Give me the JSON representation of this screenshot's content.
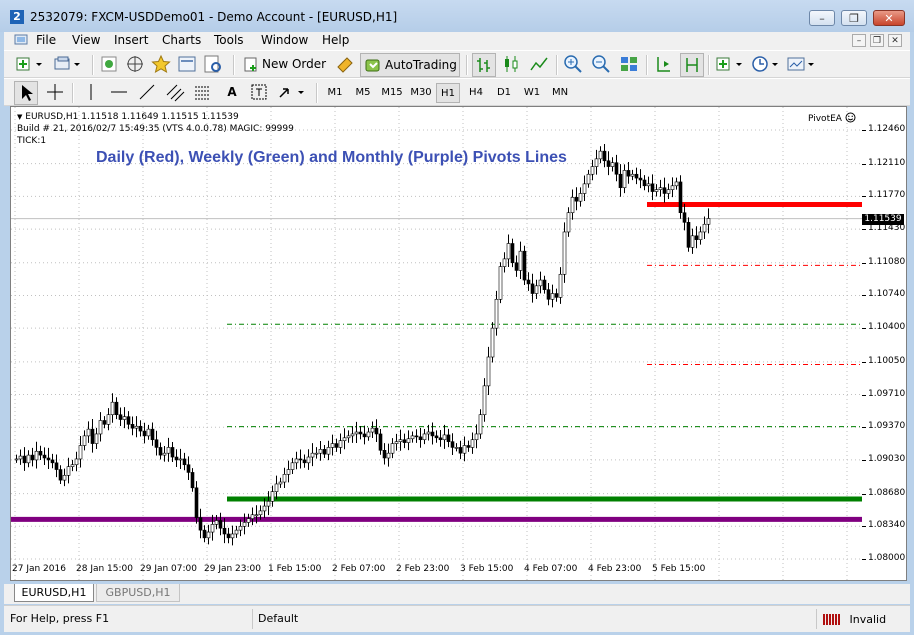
{
  "window": {
    "title": "2532079: FXCM-USDDemo01 - Demo Account - [EURUSD,H1]",
    "minimize_glyph": "–",
    "restore_glyph": "❐",
    "close_glyph": "✕"
  },
  "menu": {
    "items": [
      "File",
      "View",
      "Insert",
      "Charts",
      "Tools",
      "Window",
      "Help"
    ]
  },
  "toolbar": {
    "new_order_label": "New Order",
    "autotrading_label": "AutoTrading",
    "draw_text_tool": "A",
    "timeframes": [
      "M1",
      "M5",
      "M15",
      "M30",
      "H1",
      "H4",
      "D1",
      "W1",
      "MN"
    ],
    "active_timeframe": "H1"
  },
  "chart": {
    "symbol_info": "EURUSD,H1  1.11518 1.11649 1.11515 1.11539",
    "build_info": "Build # 21, 2016/02/7 15:49:35  (VTS 4.0.0.78) MAGIC: 99999",
    "tick_info": "TICK:1",
    "ea_name": "PivotEA",
    "annotation": "Daily (Red), Weekly (Green) and Monthly (Purple) Pivots Lines",
    "current_price": "1.11539",
    "price_labels": [
      "1.12460",
      "1.12110",
      "1.11770",
      "1.11430",
      "1.11080",
      "1.10740",
      "1.10400",
      "1.10050",
      "1.09710",
      "1.09370",
      "1.09030",
      "1.08680",
      "1.08340",
      "1.08000"
    ],
    "time_labels": [
      "27 Jan 2016",
      "28 Jan 15:00",
      "29 Jan 07:00",
      "29 Jan 23:00",
      "1 Feb 15:00",
      "2 Feb 07:00",
      "2 Feb 23:00",
      "3 Feb 15:00",
      "4 Feb 07:00",
      "4 Feb 23:00",
      "5 Feb 15:00"
    ],
    "colors": {
      "daily_pivot": "#ff0000",
      "weekly_pivot": "#008000",
      "monthly_pivot": "#800080",
      "candles": "#000000",
      "grid": "#c0c0c0"
    }
  },
  "chart_data": {
    "type": "candlestick",
    "symbol": "EURUSD",
    "timeframe": "H1",
    "ylim": [
      1.0795,
      1.1262
    ],
    "grid": true,
    "close_series": [
      1.0904,
      1.0907,
      1.09,
      1.0908,
      1.0903,
      1.0912,
      1.0908,
      1.0905,
      1.0903,
      1.09,
      1.0893,
      1.0882,
      1.0887,
      1.0896,
      1.0898,
      1.0904,
      1.0918,
      1.0928,
      1.0935,
      1.092,
      1.093,
      1.0944,
      1.094,
      1.095,
      1.0963,
      1.095,
      1.0945,
      1.0948,
      1.094,
      1.0936,
      1.0938,
      1.0933,
      1.0928,
      1.0935,
      1.0924,
      1.0916,
      1.0908,
      1.091,
      1.0916,
      1.0906,
      1.0903,
      1.0904,
      1.0898,
      1.089,
      1.0874,
      1.0843,
      1.083,
      1.0822,
      1.0828,
      1.0836,
      1.084,
      1.0832,
      1.0826,
      1.0822,
      1.0826,
      1.083,
      1.0834,
      1.0838,
      1.0842,
      1.0846,
      1.0846,
      1.085,
      1.0855,
      1.086,
      1.087,
      1.0878,
      1.088,
      1.0888,
      1.0893,
      1.09,
      1.0904,
      1.0903,
      1.09,
      1.0906,
      1.091,
      1.091,
      1.0914,
      1.0909,
      1.0916,
      1.092,
      1.0916,
      1.0923,
      1.0926,
      1.0928,
      1.093,
      1.0932,
      1.093,
      1.0927,
      1.0932,
      1.0936,
      1.093,
      1.0913,
      1.0905,
      1.091,
      1.092,
      1.0922,
      1.0924,
      1.0921,
      1.0925,
      1.0928,
      1.0927,
      1.0924,
      1.093,
      1.0932,
      1.0928,
      1.0926,
      1.0924,
      1.0929,
      1.0922,
      1.0916,
      1.0916,
      1.091,
      1.0918,
      1.0916,
      1.0924,
      1.093,
      1.095,
      1.098,
      1.101,
      1.104,
      1.107,
      1.1104,
      1.1112,
      1.1128,
      1.1108,
      1.11,
      1.112,
      1.109,
      1.1086,
      1.1076,
      1.1084,
      1.109,
      1.108,
      1.107,
      1.1076,
      1.1072,
      1.1096,
      1.114,
      1.116,
      1.1176,
      1.1172,
      1.118,
      1.119,
      1.12,
      1.1208,
      1.1216,
      1.1224,
      1.1214,
      1.1208,
      1.1212,
      1.12,
      1.1186,
      1.1204,
      1.1198,
      1.12,
      1.1196,
      1.1194,
      1.1188,
      1.119,
      1.1182,
      1.1184,
      1.1186,
      1.118,
      1.1184,
      1.1188,
      1.1192,
      1.116,
      1.115,
      1.1124,
      1.1136,
      1.1132,
      1.114,
      1.1148,
      1.1154
    ],
    "pivots": [
      {
        "name": "Daily (Red)",
        "style": "solid",
        "value": 1.11686,
        "from_index": 158
      },
      {
        "name": "Daily (Red)",
        "style": "dashed",
        "value": 1.11053,
        "from_index": 158
      },
      {
        "name": "Daily (Red)",
        "style": "dashed",
        "value": 1.10022,
        "from_index": 158
      },
      {
        "name": "Weekly (Green)",
        "style": "solid",
        "value": 1.08624,
        "from_index": 53
      },
      {
        "name": "Weekly (Green)",
        "style": "dashed",
        "value": 1.10441,
        "from_index": 53
      },
      {
        "name": "Weekly (Green)",
        "style": "dashed",
        "value": 1.09376,
        "from_index": 53
      },
      {
        "name": "Monthly (Purple)",
        "style": "solid",
        "value": 1.08412,
        "from_index": 0
      }
    ],
    "current_price": 1.11539
  }
}
